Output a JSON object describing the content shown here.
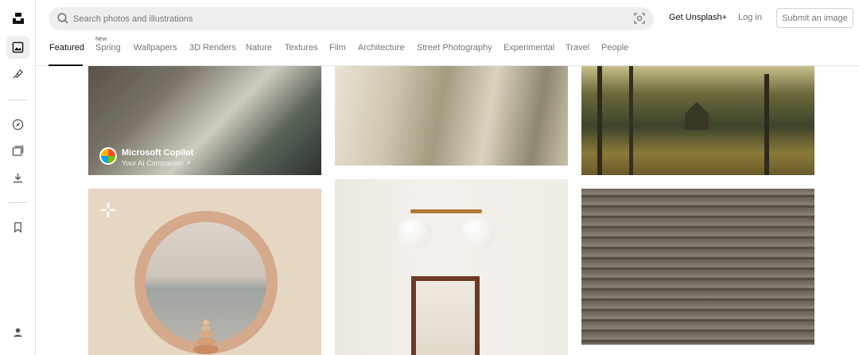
{
  "sidebar": {
    "logo": "unsplash-logo-icon",
    "items": [
      "photos-icon",
      "illustrations-icon",
      "explore-icon",
      "collections-icon",
      "downloads-icon",
      "bookmark-icon",
      "account-icon"
    ]
  },
  "search": {
    "placeholder": "Search photos and illustrations"
  },
  "header": {
    "get_plus": "Get Unsplash+",
    "login": "Log in",
    "submit": "Submit an image"
  },
  "topics": {
    "items": [
      "Featured",
      "Spring",
      "Wallpapers",
      "3D Renders",
      "Nature",
      "Textures",
      "Film",
      "Architecture",
      "Street Photography",
      "Experimental",
      "Travel",
      "People"
    ],
    "badge": "New",
    "active": "Featured"
  },
  "ad": {
    "title": "Microsoft Copilot",
    "subtitle": "Your AI Companion ↗"
  },
  "colors": {
    "accent": "#111111",
    "muted": "#767676",
    "search_bg": "#eeeeee"
  }
}
